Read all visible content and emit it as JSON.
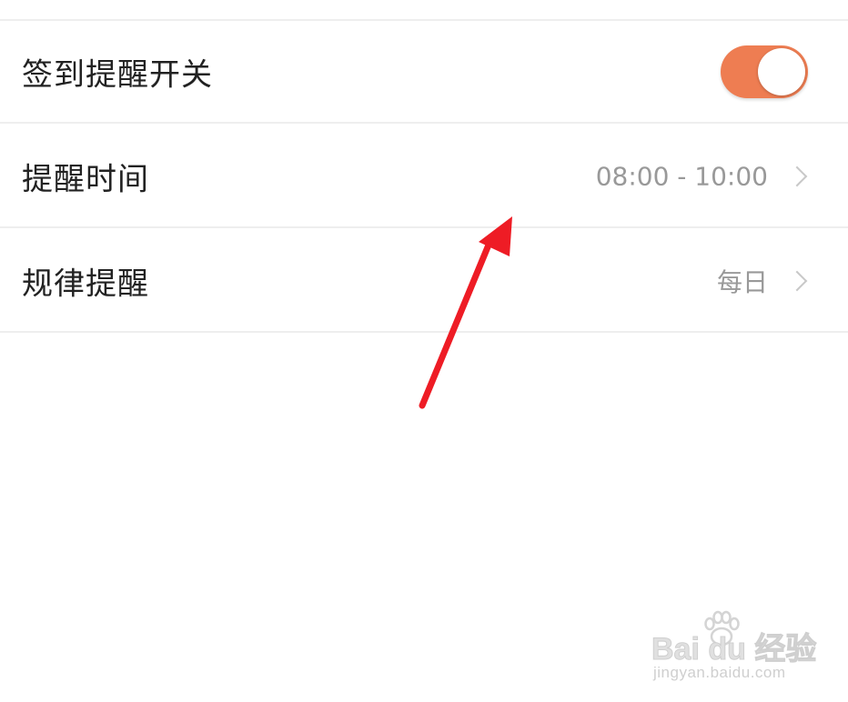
{
  "settings": {
    "rows": [
      {
        "label": "签到提醒开关",
        "type": "toggle",
        "toggle_on": true
      },
      {
        "label": "提醒时间",
        "type": "link",
        "value": "08:00 - 10:00"
      },
      {
        "label": "规律提醒",
        "type": "link",
        "value": "每日"
      }
    ]
  },
  "colors": {
    "toggle_on": "#ee7d52",
    "annotation_arrow": "#ee1c25",
    "divider": "#eeeeee"
  },
  "watermark": {
    "logo_text": "Bai du 经验",
    "url": "jingyan.baidu.com"
  },
  "icons": {
    "chevron": "chevron-right-icon",
    "arrow": "red-arrow-annotation",
    "paw": "baidu-paw-icon"
  }
}
